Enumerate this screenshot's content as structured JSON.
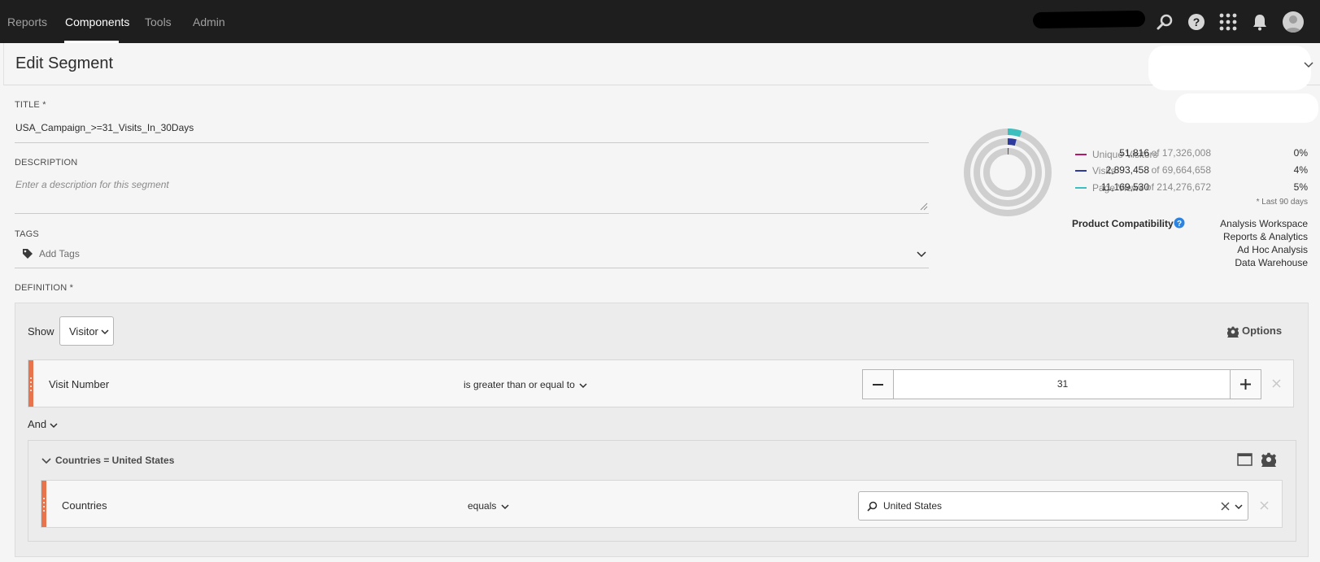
{
  "nav": {
    "tabs": [
      {
        "label": "Reports",
        "active": false
      },
      {
        "label": "Components",
        "active": true
      },
      {
        "label": "Tools",
        "active": false
      },
      {
        "label": "Admin",
        "active": false
      }
    ],
    "icons": [
      "search-icon",
      "help-icon",
      "apps-grid-icon",
      "bell-icon",
      "user-avatar"
    ]
  },
  "page": {
    "title": "Edit Segment"
  },
  "form": {
    "title_label": "TITLE *",
    "title_value": "USA_Campaign_>=31_Visits_In_30Days",
    "description_label": "DESCRIPTION",
    "description_placeholder": "Enter a description for this segment",
    "tags_label": "TAGS",
    "tags_placeholder": "Add Tags",
    "definition_label": "DEFINITION *"
  },
  "definition": {
    "show_label": "Show",
    "show_value": "Visitor",
    "options_label": "Options",
    "rule1": {
      "dimension": "Visit Number",
      "operator": "is greater than or equal to",
      "value": "31"
    },
    "logic_operator": "And",
    "container": {
      "title": "Countries = United States",
      "rule": {
        "dimension": "Countries",
        "operator": "equals",
        "value": "United States"
      }
    }
  },
  "summary": {
    "metrics": [
      {
        "name": "Unique Visitors",
        "value": "51,816",
        "of_label": "of 17,326,008",
        "percent": "0%",
        "fraction": 0.003,
        "color": "#b3186b"
      },
      {
        "name": "Visits",
        "value": "2,893,458",
        "of_label": "of 69,664,658",
        "percent": "4%",
        "fraction": 0.0415,
        "color": "#2d3a9e"
      },
      {
        "name": "Page Views",
        "value": "11,169,530",
        "of_label": "of 214,276,672",
        "percent": "5%",
        "fraction": 0.052,
        "color": "#3ebfbf"
      }
    ],
    "footnote": "* Last 90 days",
    "compatibility_title": "Product Compatibility",
    "compatibility": [
      "Analysis Workspace",
      "Reports & Analytics",
      "Ad Hoc Analysis",
      "Data Warehouse"
    ]
  },
  "colors": {
    "nav_bg": "#1e1e1e",
    "rule_handle": "#e8744d",
    "help_blue": "#2d84e0"
  }
}
